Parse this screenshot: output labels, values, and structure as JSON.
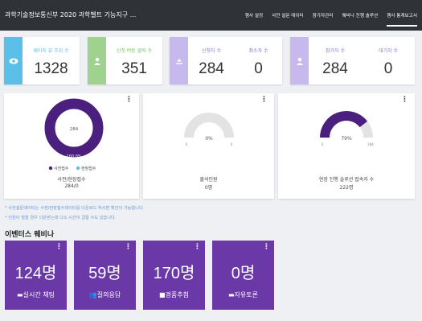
{
  "topbar": {
    "title": "과학기술정보통신부 2020 과학벨트 기능지구 ...",
    "nav": [
      "행사 설정",
      "사전 설문 데이터",
      "참가자관리",
      "웨비나 진행 솔루션",
      "행사 통계보고서"
    ]
  },
  "stats": {
    "page_views": {
      "label": "페이지 뷰 조회 수",
      "value": "1328"
    },
    "pre_survey": {
      "label": "신청 버튼 클릭 수",
      "value": "351"
    },
    "applicants": {
      "label": "신청자 수",
      "value": "284"
    },
    "cancelled": {
      "label": "취소자 수",
      "value": "0"
    },
    "participants": {
      "label": "참가자 수",
      "value": "284"
    },
    "waiting": {
      "label": "대기자 수",
      "value": "0"
    }
  },
  "cards": {
    "pre_onsite": {
      "center_value": "284",
      "pct": "100.0%",
      "legend_a": "사전접수",
      "legend_b": "현장접수",
      "caption": "사전/현장접수",
      "sub": "284/0",
      "fraction": 1.0
    },
    "attendance": {
      "center": "0%",
      "min": "0",
      "max": "0",
      "caption": "출석인원",
      "sub": "0명",
      "fraction": 0.0
    },
    "onsite_solution": {
      "center": "79%",
      "min": "0",
      "max": "284",
      "caption": "현장 진행 솔루션 접속자 수",
      "sub": "222명",
      "fraction": 0.79
    }
  },
  "notes": [
    "* 사전설문데이터는 사전/현장접수데이터를 다운로드 하시면 확인이 가능합니다.",
    "* 인원이 많을 경우 다운받는데 다소 시간이 걸릴 수도 있습니다."
  ],
  "section_title": "이벤터스 웨비나",
  "webinar": [
    {
      "value": "124명",
      "label": "실시간 채팅",
      "icon": "chat-icon"
    },
    {
      "value": "59명",
      "label": "질의응답",
      "icon": "users-icon"
    },
    {
      "value": "170명",
      "label": "경품추첨",
      "icon": "gift-icon"
    },
    {
      "value": "0명",
      "label": "자유토론",
      "icon": "comment-icon"
    }
  ],
  "colors": {
    "topbar": "#2f3237",
    "blue": "#5bc0e8",
    "green": "#9ed28e",
    "lavender": "#c7b8ee",
    "purple": "#4a1f7e",
    "webinar": "#6b38a8",
    "gauge_bg": "#e3e3e3",
    "note": "#6a98d6"
  }
}
